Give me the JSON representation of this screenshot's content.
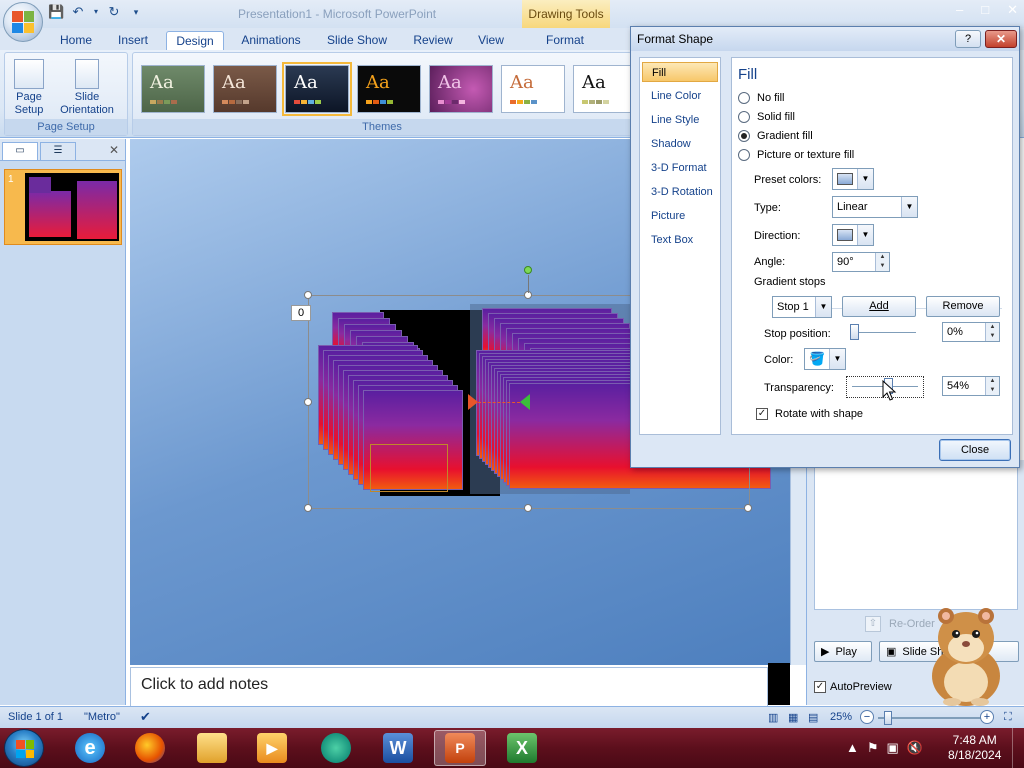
{
  "window": {
    "title": "Presentation1 - Microsoft PowerPoint",
    "context_tab_group": "Drawing Tools"
  },
  "ribbon": {
    "tabs": [
      "Home",
      "Insert",
      "Design",
      "Animations",
      "Slide Show",
      "Review",
      "View",
      "Format"
    ],
    "active_tab": "Design",
    "page_setup_group": {
      "page_setup_label": "Page Setup",
      "slide_orientation_label": "Slide Orientation",
      "group_label": "Page Setup"
    },
    "themes_group_label": "Themes",
    "theme_sample": "Aa"
  },
  "slides_pane": {
    "slide_number": "1"
  },
  "slide": {
    "page_badge": "0"
  },
  "notes": {
    "placeholder": "Click to add notes"
  },
  "task_pane": {
    "reorder_label": "Re-Order",
    "play_label": "Play",
    "slide_show_label": "Slide Show",
    "autopreview_label": "AutoPreview",
    "autopreview_checked": true
  },
  "status_bar": {
    "slide_info": "Slide 1 of 1",
    "theme_name": "\"Metro\"",
    "zoom": "25%"
  },
  "taskbar": {
    "time": "7:48 AM",
    "date": "8/18/2024",
    "apps": [
      "internet-explorer",
      "firefox",
      "file-explorer",
      "media-player",
      "browser",
      "word",
      "powerpoint",
      "excel"
    ],
    "active_app": "powerpoint"
  },
  "dialog": {
    "title": "Format Shape",
    "help_label": "?",
    "close_x": "✕",
    "categories": [
      "Fill",
      "Line Color",
      "Line Style",
      "Shadow",
      "3-D Format",
      "3-D Rotation",
      "Picture",
      "Text Box"
    ],
    "active_category": "Fill",
    "panel_heading": "Fill",
    "fill_options": [
      "No fill",
      "Solid fill",
      "Gradient fill",
      "Picture or texture fill"
    ],
    "selected_fill": "Gradient fill",
    "preset_colors_label": "Preset colors:",
    "type_label": "Type:",
    "type_value": "Linear",
    "direction_label": "Direction:",
    "angle_label": "Angle:",
    "angle_value": "90°",
    "gradient_stops_label": "Gradient stops",
    "stop_value": "Stop 1",
    "add_label": "Add",
    "remove_label": "Remove",
    "stop_position_label": "Stop position:",
    "stop_position_value": "0%",
    "stop_position_fraction": 0.0,
    "color_label": "Color:",
    "transparency_label": "Transparency:",
    "transparency_value": "54%",
    "transparency_fraction": 0.54,
    "rotate_label": "Rotate with shape",
    "rotate_checked": true,
    "close_button_label": "Close"
  }
}
